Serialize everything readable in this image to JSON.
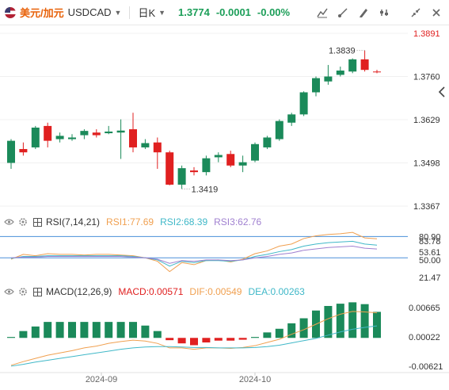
{
  "header": {
    "symbol_cn": "美元/加元",
    "symbol_code": "USDCAD",
    "period": "日K",
    "price": "1.3774",
    "change": "-0.0001",
    "change_pct": "-0.00%"
  },
  "toolbar_icons": [
    "chart-type-icon",
    "draw-icon",
    "pen-icon",
    "settings-icon",
    "collapse-icon",
    "close-icon"
  ],
  "colors": {
    "up": "#1b8a5a",
    "down": "#e02020",
    "rsi1": "#f0a050",
    "rsi2": "#40b8c8",
    "rsi3": "#a080d0",
    "dif": "#f0a050",
    "dea": "#40b8c8",
    "level_line": "#4a90d9"
  },
  "price_axis": {
    "labels": [
      "1.3891",
      "1.3760",
      "1.3629",
      "1.3498",
      "1.3367"
    ],
    "high_label": "1.3891",
    "range": [
      1.3367,
      1.3891
    ]
  },
  "annotations": {
    "max": "1.3839",
    "min": "1.3419"
  },
  "chart_data": [
    {
      "type": "candlestick",
      "title": "USDCAD 日K",
      "ylim": [
        1.3367,
        1.3891
      ],
      "candles": [
        {
          "o": 1.3498,
          "h": 1.357,
          "l": 1.348,
          "c": 1.3565
        },
        {
          "o": 1.354,
          "h": 1.356,
          "l": 1.352,
          "c": 1.353
        },
        {
          "o": 1.3545,
          "h": 1.361,
          "l": 1.354,
          "c": 1.3605
        },
        {
          "o": 1.361,
          "h": 1.362,
          "l": 1.3545,
          "c": 1.3565
        },
        {
          "o": 1.357,
          "h": 1.359,
          "l": 1.356,
          "c": 1.358
        },
        {
          "o": 1.357,
          "h": 1.3585,
          "l": 1.3565,
          "c": 1.3575
        },
        {
          "o": 1.3582,
          "h": 1.36,
          "l": 1.357,
          "c": 1.3595
        },
        {
          "o": 1.359,
          "h": 1.36,
          "l": 1.3575,
          "c": 1.3582
        },
        {
          "o": 1.3588,
          "h": 1.361,
          "l": 1.3585,
          "c": 1.3593
        },
        {
          "o": 1.359,
          "h": 1.363,
          "l": 1.351,
          "c": 1.3596
        },
        {
          "o": 1.36,
          "h": 1.365,
          "l": 1.353,
          "c": 1.3545
        },
        {
          "o": 1.3545,
          "h": 1.357,
          "l": 1.354,
          "c": 1.3558
        },
        {
          "o": 1.356,
          "h": 1.3575,
          "l": 1.348,
          "c": 1.353
        },
        {
          "o": 1.353,
          "h": 1.3535,
          "l": 1.343,
          "c": 1.3432
        },
        {
          "o": 1.3432,
          "h": 1.349,
          "l": 1.3419,
          "c": 1.3482
        },
        {
          "o": 1.3475,
          "h": 1.3485,
          "l": 1.346,
          "c": 1.347
        },
        {
          "o": 1.347,
          "h": 1.352,
          "l": 1.346,
          "c": 1.3512
        },
        {
          "o": 1.3515,
          "h": 1.353,
          "l": 1.35,
          "c": 1.3522
        },
        {
          "o": 1.3525,
          "h": 1.3535,
          "l": 1.3485,
          "c": 1.349
        },
        {
          "o": 1.349,
          "h": 1.352,
          "l": 1.347,
          "c": 1.35
        },
        {
          "o": 1.3505,
          "h": 1.356,
          "l": 1.35,
          "c": 1.3555
        },
        {
          "o": 1.3545,
          "h": 1.358,
          "l": 1.354,
          "c": 1.3575
        },
        {
          "o": 1.357,
          "h": 1.363,
          "l": 1.3565,
          "c": 1.3625
        },
        {
          "o": 1.362,
          "h": 1.365,
          "l": 1.361,
          "c": 1.3645
        },
        {
          "o": 1.3645,
          "h": 1.3715,
          "l": 1.364,
          "c": 1.3712
        },
        {
          "o": 1.3712,
          "h": 1.376,
          "l": 1.37,
          "c": 1.3755
        },
        {
          "o": 1.3745,
          "h": 1.3795,
          "l": 1.3735,
          "c": 1.376
        },
        {
          "o": 1.3765,
          "h": 1.379,
          "l": 1.376,
          "c": 1.3778
        },
        {
          "o": 1.3775,
          "h": 1.3815,
          "l": 1.377,
          "c": 1.3812
        },
        {
          "o": 1.3812,
          "h": 1.3839,
          "l": 1.3775,
          "c": 1.378
        },
        {
          "o": 1.3775,
          "h": 1.378,
          "l": 1.377,
          "c": 1.3774
        }
      ],
      "xticks": [
        "2024-09",
        "2024-10"
      ]
    },
    {
      "type": "line",
      "title": "RSI(7,14,21)",
      "ylim": [
        21.47,
        86
      ],
      "y_labels": [
        "80.90",
        "83.78",
        "53.61",
        "50.00",
        "21.47"
      ],
      "series": [
        {
          "name": "RSI1:77.69",
          "values": [
            48,
            55,
            53,
            56,
            55,
            55,
            54,
            55,
            55,
            54,
            53,
            50,
            45,
            30,
            43,
            40,
            46,
            47,
            44,
            48,
            56,
            60,
            67,
            70,
            78,
            82,
            84,
            85,
            87,
            79,
            77.69
          ]
        },
        {
          "name": "RSI2:68.39",
          "values": [
            49,
            52,
            52,
            53,
            53,
            53,
            53,
            53,
            53,
            53,
            52,
            50,
            47,
            38,
            45,
            43,
            46,
            46,
            45,
            47,
            52,
            55,
            59,
            62,
            67,
            70,
            72,
            73,
            74,
            70,
            68.39
          ]
        },
        {
          "name": "RSI3:62.76",
          "values": [
            50,
            51,
            51,
            52,
            52,
            52,
            52,
            52,
            52,
            52,
            51,
            50,
            48,
            42,
            46,
            45,
            47,
            47,
            46,
            47,
            50,
            52,
            55,
            57,
            61,
            63,
            65,
            66,
            67,
            64,
            62.76
          ]
        }
      ]
    },
    {
      "type": "bar+line",
      "title": "MACD(12,26,9)",
      "ylim": [
        -0.00621,
        0.00665
      ],
      "y_labels": [
        "0.00665",
        "0.00022",
        "-0.00621"
      ],
      "macd_label": "MACD:0.00571",
      "dif_label": "DIF:0.00549",
      "dea_label": "DEA:0.00263",
      "macd": [
        0.0002,
        0.0015,
        0.0025,
        0.0035,
        0.0035,
        0.0035,
        0.0035,
        0.0035,
        0.0035,
        0.0035,
        0.0035,
        0.0027,
        0.0015,
        -0.0005,
        -0.0012,
        -0.0016,
        -0.001,
        -0.0006,
        -0.0006,
        -0.0004,
        0.0002,
        0.0012,
        0.002,
        0.0032,
        0.0043,
        0.006,
        0.007,
        0.0075,
        0.0078,
        0.0074,
        0.00571
      ],
      "dif": [
        -0.006,
        -0.0052,
        -0.0045,
        -0.0038,
        -0.0033,
        -0.0028,
        -0.0022,
        -0.0018,
        -0.0012,
        -0.0008,
        -0.0005,
        -0.0007,
        -0.0012,
        -0.0022,
        -0.0022,
        -0.0025,
        -0.0022,
        -0.0022,
        -0.0023,
        -0.0021,
        -0.0017,
        -0.001,
        -0.0003,
        0.0008,
        0.0018,
        0.003,
        0.0042,
        0.0052,
        0.0058,
        0.0057,
        0.00549
      ],
      "dea": [
        -0.0062,
        -0.0058,
        -0.0053,
        -0.0049,
        -0.0045,
        -0.0041,
        -0.0037,
        -0.0033,
        -0.0029,
        -0.0025,
        -0.0022,
        -0.002,
        -0.0019,
        -0.0019,
        -0.002,
        -0.0021,
        -0.0021,
        -0.0022,
        -0.0022,
        -0.0022,
        -0.0021,
        -0.0019,
        -0.0016,
        -0.0011,
        -0.0006,
        -0.0001,
        0.0006,
        0.0013,
        0.0019,
        0.0023,
        0.00263
      ]
    }
  ],
  "rsi_panel": {
    "title": "RSI(7,14,21)",
    "rsi1": "RSI1:77.69",
    "rsi2": "RSI2:68.39",
    "rsi3": "RSI3:62.76"
  },
  "macd_panel": {
    "title": "MACD(12,26,9)",
    "macd": "MACD:0.00571",
    "dif": "DIF:0.00549",
    "dea": "DEA:0.00263"
  },
  "x_axis": {
    "labels": [
      "2024-09",
      "2024-10"
    ]
  }
}
